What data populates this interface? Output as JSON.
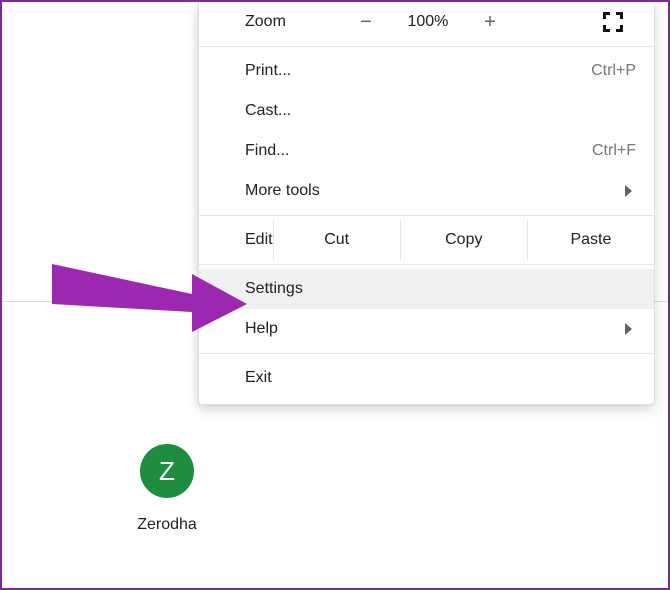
{
  "menu": {
    "zoom_label": "Zoom",
    "zoom_value": "100%",
    "zoom_minus": "−",
    "zoom_plus": "+",
    "print_label": "Print...",
    "print_shortcut": "Ctrl+P",
    "cast_label": "Cast...",
    "find_label": "Find...",
    "find_shortcut": "Ctrl+F",
    "more_tools_label": "More tools",
    "edit_label": "Edit",
    "cut_label": "Cut",
    "copy_label": "Copy",
    "paste_label": "Paste",
    "settings_label": "Settings",
    "help_label": "Help",
    "exit_label": "Exit"
  },
  "shortcut": {
    "initial": "Z",
    "name": "Zerodha"
  }
}
